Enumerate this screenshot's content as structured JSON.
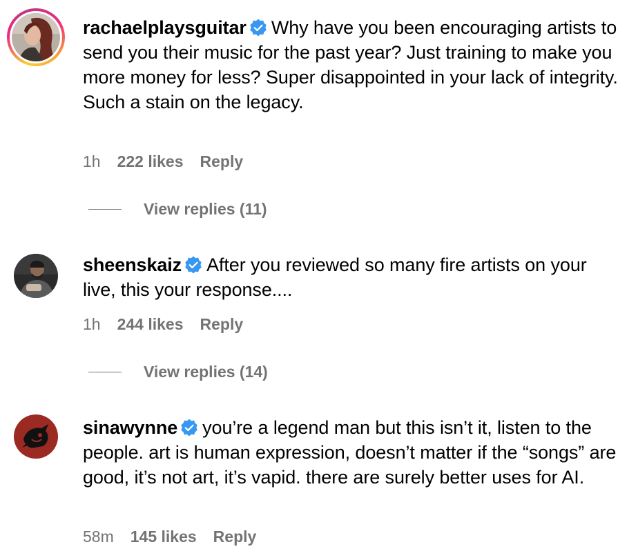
{
  "comments": [
    {
      "username": "rachaelplaysguitar",
      "text": "Why have you been encouraging artists to send you their music for the past year? Just training to make you more money for less? Super disappointed in your lack of integrity. Such a stain on the legacy.",
      "time": "1h",
      "likes": "222 likes",
      "reply": "Reply",
      "view_replies": "View replies (11)",
      "avatar_icon": "profile-photo-woman"
    },
    {
      "username": "sheenskaiz",
      "text": "After you reviewed so many fire artists on your live, this your response....",
      "time": "1h",
      "likes": "244 likes",
      "reply": "Reply",
      "view_replies": "View replies (14)",
      "avatar_icon": "profile-photo-man"
    },
    {
      "username": "sinawynne",
      "text": "you’re a legend man but this isn’t it, listen to the people. art is human expression, doesn’t matter if the “songs” are good, it’s not art, it’s vapid. there are surely better uses for AI.",
      "time": "58m",
      "likes": "145 likes",
      "reply": "Reply",
      "avatar_icon": "profile-photo-red-emblem"
    }
  ],
  "colors": {
    "verified": "#3897f0",
    "secondary_text": "#737373",
    "text": "#000000",
    "background": "#ffffff"
  }
}
